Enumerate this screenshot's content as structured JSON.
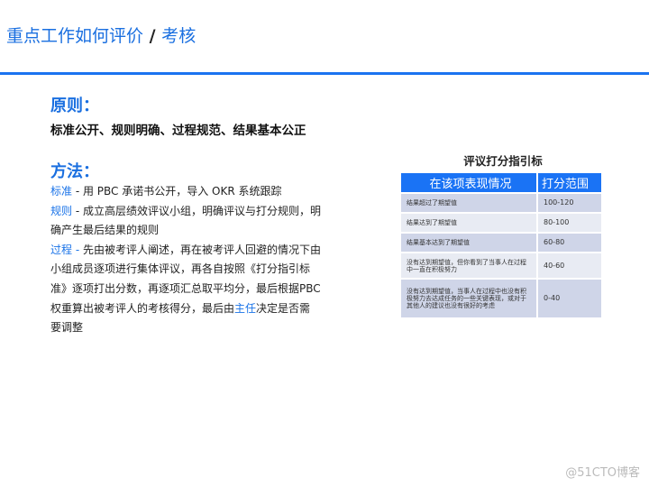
{
  "title": {
    "main": "重点工作如何评价",
    "sep": " / ",
    "sub": "考核"
  },
  "principle": {
    "heading": "原则：",
    "text": "标准公开、规则明确、过程规范、结果基本公正"
  },
  "method": {
    "heading": "方法：",
    "items": [
      {
        "key": "标准",
        "text": " - 用 PBC 承诺书公开，导入 OKR 系统跟踪"
      },
      {
        "key": "规则",
        "text": " - 成立高层绩效评议小组，明确评议与打分规则，明确产生最后结果的规则"
      },
      {
        "key": "过程 -",
        "text": " 先由被考评人阐述，再在被考评人回避的情况下由小组成员逐项进行集体评议，再各自按照《打分指引标准》逐项打出分数，再逐项汇总取平均分，最后根据PBC 权重算出被考评人的考核得分，最后由",
        "key2": "主任",
        "text2": "决定是否需要调整"
      }
    ]
  },
  "table": {
    "title": "评议打分指引标",
    "headers": [
      "在该项表现情况",
      "打分范围"
    ],
    "rows": [
      [
        "结果超过了期望值",
        "100-120"
      ],
      [
        "结果达到了期望值",
        "80-100"
      ],
      [
        "结果基本达到了期望值",
        "60-80"
      ],
      [
        "没有达到期望值，但你看到了当事人在过程中一直在积极努力",
        "40-60"
      ],
      [
        "没有达到期望值，当事人在过程中也没有积极努力去达成任务的一些关键表现，或对于其他人的建议也没有很好的考虑",
        "0-40"
      ]
    ]
  },
  "watermark": "@51CTO博客"
}
